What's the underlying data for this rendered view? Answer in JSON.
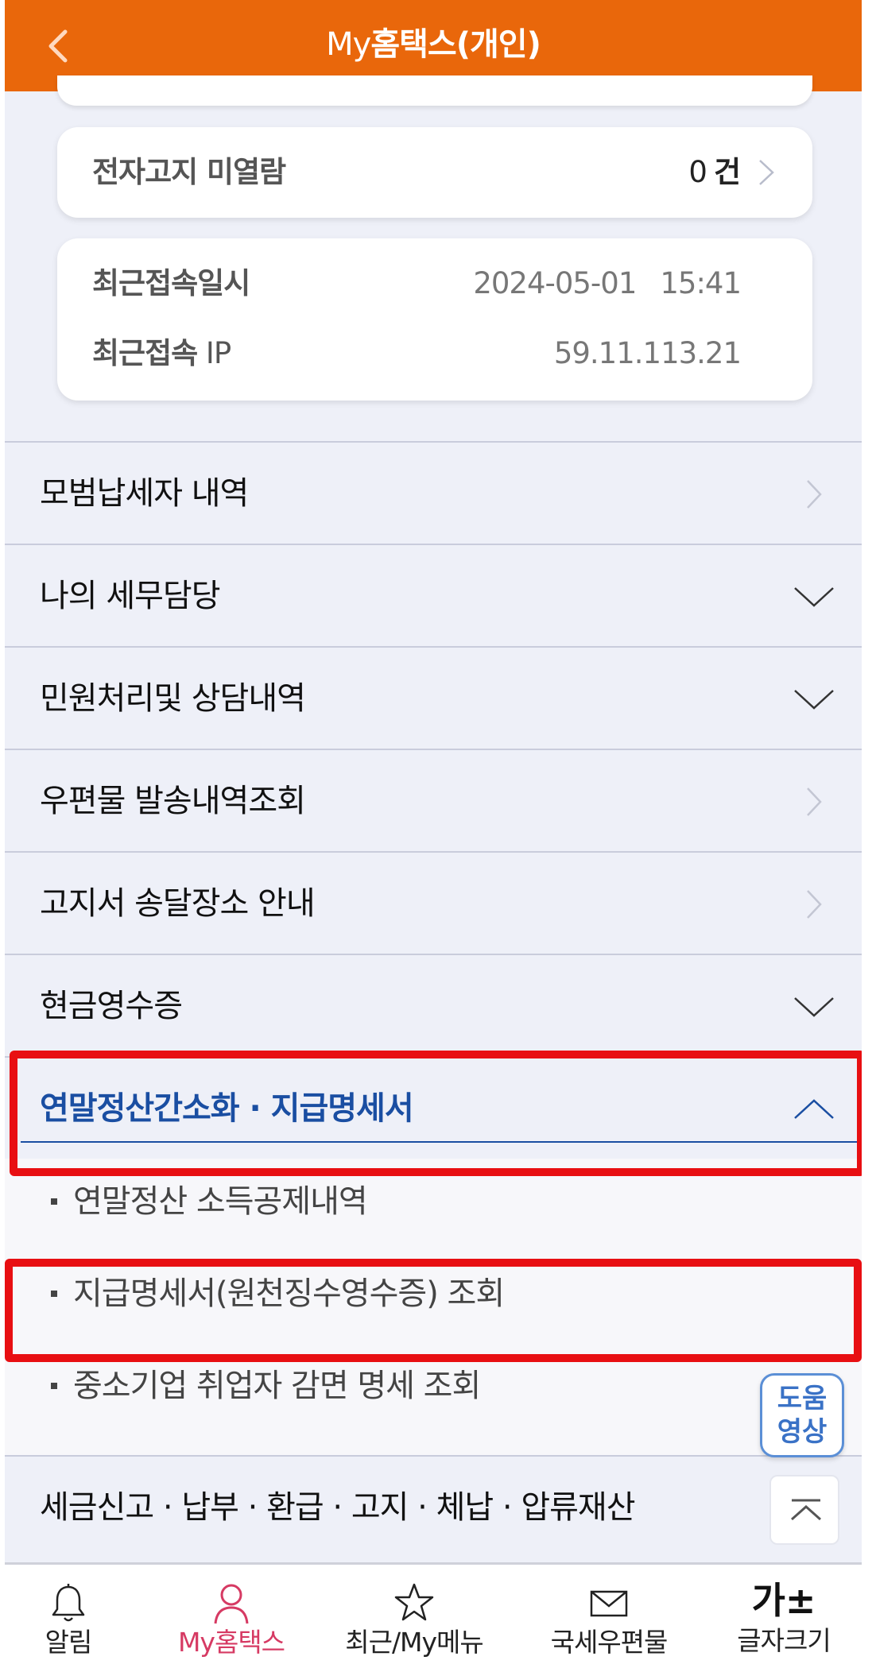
{
  "header": {
    "title_prefix": "My",
    "title_main": "홈택스(개인)",
    "back_icon": "chevron-left-icon",
    "bg_color": "#e9670b"
  },
  "notice_card": {
    "label": "전자고지 미열람",
    "count": "0",
    "unit": "건"
  },
  "access_card": {
    "last_login_label": "최근접속일시",
    "last_login_date": "2024-05-01",
    "last_login_time": "15:41",
    "last_ip_label_bold": "최근접속",
    "last_ip_label_rest": " IP",
    "last_ip_value": "59.11.113.21"
  },
  "menu": {
    "items": [
      {
        "label": "모범납세자 내역",
        "icon": "chevron-right-icon"
      },
      {
        "label": "나의 세무담당",
        "icon": "chevron-down-icon"
      },
      {
        "label": "민원처리및 상담내역",
        "icon": "chevron-down-icon"
      },
      {
        "label": "우편물 발송내역조회",
        "icon": "chevron-right-icon"
      },
      {
        "label": "고지서 송달장소 안내",
        "icon": "chevron-right-icon"
      },
      {
        "label": "현금영수증",
        "icon": "chevron-down-icon"
      },
      {
        "label": "연말정산간소화 · 지급명세서",
        "icon": "chevron-up-icon"
      }
    ],
    "sub_items": [
      {
        "label": "연말정산 소득공제내역"
      },
      {
        "label": "지급명세서(원천징수영수증) 조회"
      },
      {
        "label": "중소기업 취업자 감면 명세 조회"
      }
    ],
    "last_item": {
      "label": "세금신고 · 납부 · 환급 · 고지 · 체납 · 압류재산"
    }
  },
  "help_button": {
    "line1": "도움",
    "line2": "영상"
  },
  "scroll_top_icon": "scroll-top-icon",
  "bottom_nav": [
    {
      "label": "알림",
      "icon": "bell-icon"
    },
    {
      "label": "My홈택스",
      "icon": "person-icon",
      "current": true
    },
    {
      "label": "최근/My메뉴",
      "icon": "star-icon"
    },
    {
      "label": "국세우편물",
      "icon": "mail-icon"
    },
    {
      "label": "글자크기",
      "icon": "font-size-icon",
      "glyph": "가±"
    }
  ],
  "colors": {
    "accent": "#e9670b",
    "active_text": "#1a4ea2",
    "highlight": "#e80f12",
    "nav_current": "#d63a63"
  }
}
